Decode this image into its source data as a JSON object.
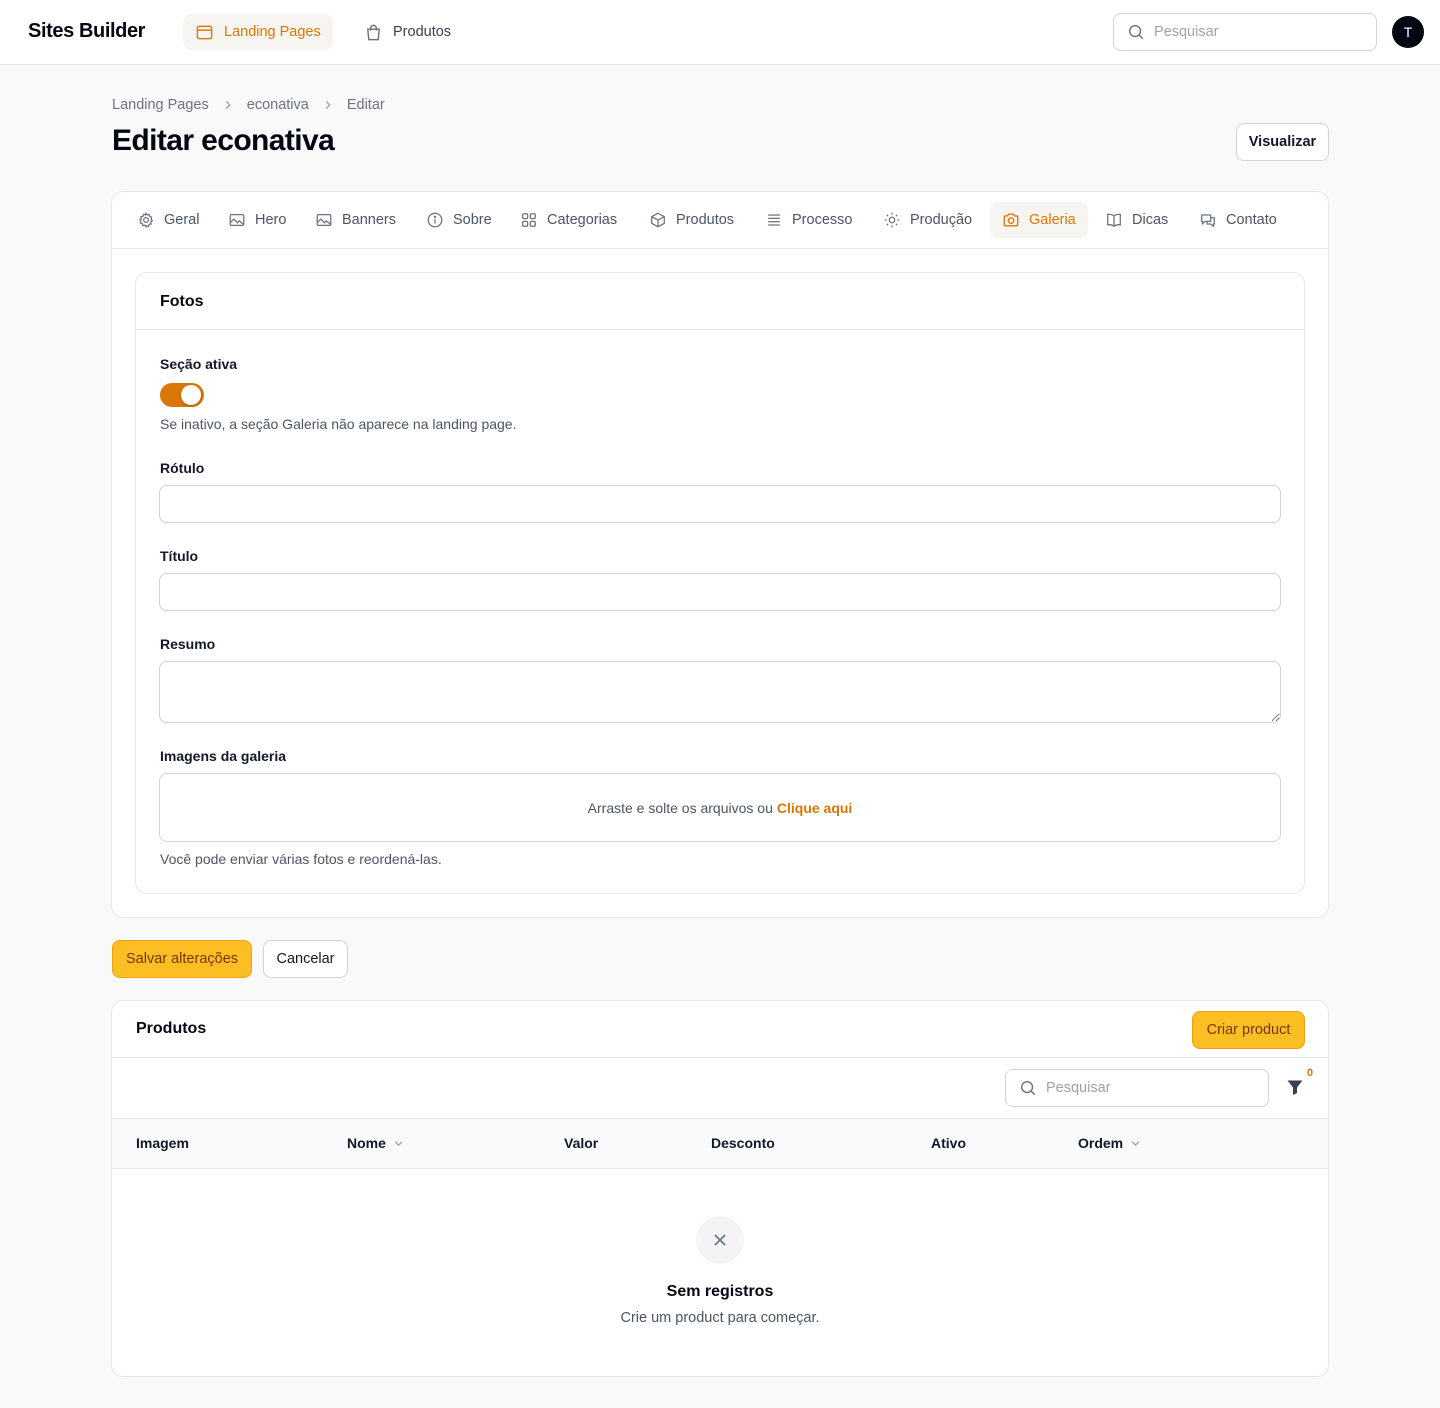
{
  "app": {
    "brand": "Sites Builder",
    "avatar_initial": "T"
  },
  "nav": [
    {
      "label": "Landing Pages",
      "icon": "window-icon",
      "active": true
    },
    {
      "label": "Produtos",
      "icon": "shopping-bag-icon",
      "active": false
    }
  ],
  "top_search": {
    "placeholder": "Pesquisar"
  },
  "breadcrumb": [
    "Landing Pages",
    "econativa",
    "Editar"
  ],
  "page": {
    "title": "Editar econativa",
    "view_label": "Visualizar"
  },
  "tabs": [
    "Geral",
    "Hero",
    "Banners",
    "Sobre",
    "Categorias",
    "Produtos",
    "Processo",
    "Produção",
    "Galeria",
    "Dicas",
    "Contato"
  ],
  "active_tab": "Galeria",
  "section": {
    "title": "Fotos",
    "toggle_label": "Seção ativa",
    "toggle_on": true,
    "toggle_hint": "Se inativo, a seção Galeria não aparece na landing page.",
    "rotulo_label": "Rótulo",
    "rotulo_value": "",
    "titulo_label": "Título",
    "titulo_value": "",
    "resumo_label": "Resumo",
    "resumo_value": "",
    "images_label": "Imagens da galeria",
    "dropzone_text": "Arraste e solte os arquivos ou",
    "dropzone_link": "Clique aqui",
    "images_hint": "Você pode enviar várias fotos e reordená-las."
  },
  "actions": {
    "save": "Salvar alterações",
    "cancel": "Cancelar"
  },
  "products": {
    "title": "Produtos",
    "create_label": "Criar product",
    "search_placeholder": "Pesquisar",
    "filter_count": "0",
    "columns": [
      "Imagem",
      "Nome",
      "Valor",
      "Desconto",
      "Ativo",
      "Ordem"
    ],
    "empty_title": "Sem registros",
    "empty_sub": "Crie um product para começar."
  },
  "colors": {
    "accent": "#d97706",
    "primary_button": "#fbbf24"
  }
}
